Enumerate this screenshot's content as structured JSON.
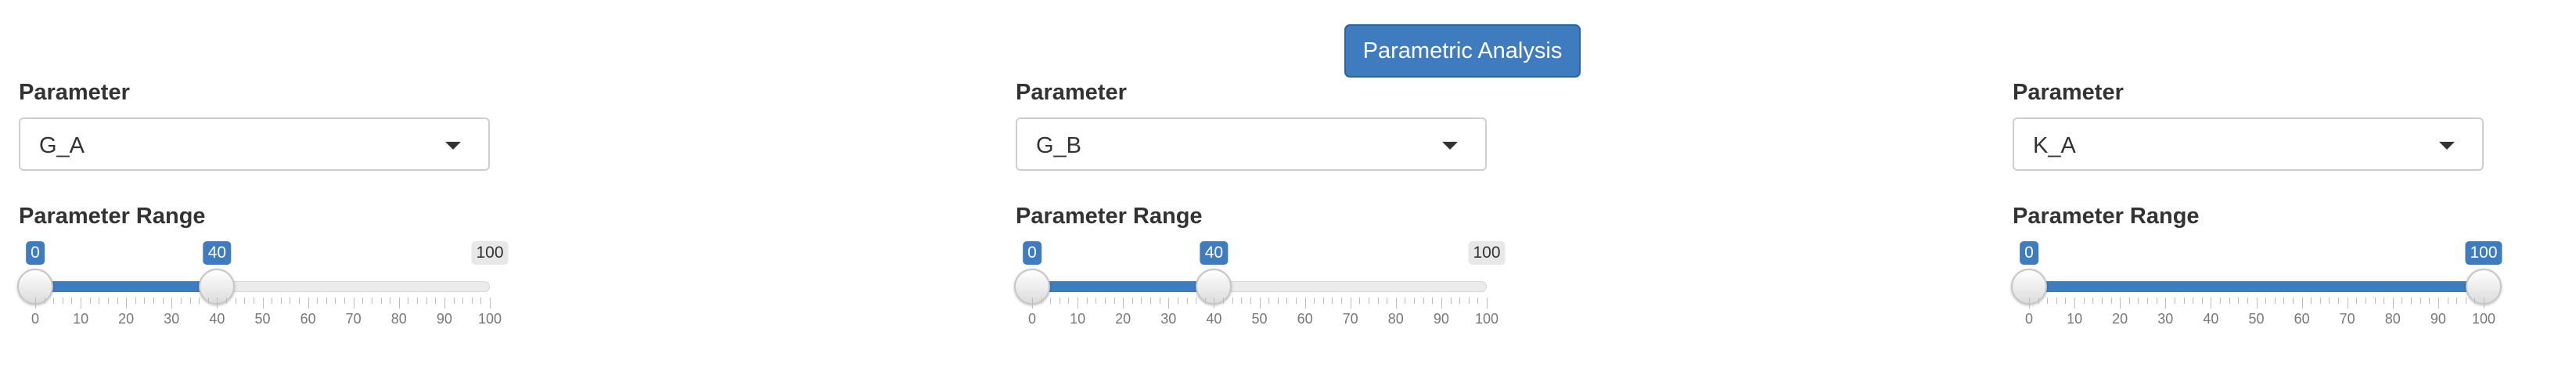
{
  "top_button": {
    "label": "Parametric Analysis"
  },
  "panels": [
    {
      "parameter_label": "Parameter",
      "selected": "G_A",
      "range_label": "Parameter Range",
      "min": 0,
      "max": 100,
      "from": 0,
      "to": 40,
      "min_label": "0",
      "from_label": "0",
      "to_label": "40",
      "max_label": "100",
      "max_label_visible": true
    },
    {
      "parameter_label": "Parameter",
      "selected": "G_B",
      "range_label": "Parameter Range",
      "min": 0,
      "max": 100,
      "from": 0,
      "to": 40,
      "min_label": "0",
      "from_label": "0",
      "to_label": "40",
      "max_label": "100",
      "max_label_visible": true
    },
    {
      "parameter_label": "Parameter",
      "selected": "K_A",
      "range_label": "Parameter Range",
      "min": 0,
      "max": 100,
      "from": 0,
      "to": 100,
      "min_label": "0",
      "from_label": "0",
      "to_label": "100",
      "max_label": "100",
      "max_label_visible": false
    }
  ],
  "tick_labels": [
    "0",
    "10",
    "20",
    "30",
    "40",
    "50",
    "60",
    "70",
    "80",
    "90",
    "100"
  ],
  "colors": {
    "accent": "#3f7cbf",
    "track": "#ebebeb"
  }
}
